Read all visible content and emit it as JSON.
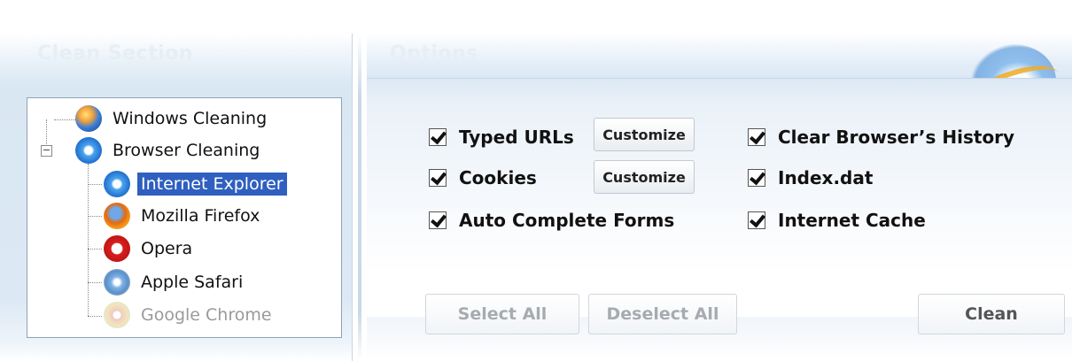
{
  "left_panel": {
    "title": "Clean Section",
    "tree": [
      {
        "label": "Windows Cleaning",
        "icon": "windows-icon"
      },
      {
        "label": "Browser Cleaning",
        "icon": "ie-icon",
        "expanded": true
      },
      {
        "label": "Internet Explorer",
        "icon": "ie-icon",
        "selected": true
      },
      {
        "label": "Mozilla Firefox",
        "icon": "firefox-icon"
      },
      {
        "label": "Opera",
        "icon": "opera-icon"
      },
      {
        "label": "Apple Safari",
        "icon": "safari-icon"
      },
      {
        "label": "Google Chrome",
        "icon": "chrome-icon",
        "disabled": true
      }
    ],
    "expander_symbol": "−"
  },
  "right_panel": {
    "title": "Options",
    "options": [
      {
        "label": "Typed URLs",
        "checked": true
      },
      {
        "label": "Cookies",
        "checked": true
      },
      {
        "label": "Auto Complete Forms",
        "checked": true
      },
      {
        "label": "Clear Browser’s History",
        "checked": true
      },
      {
        "label": "Index.dat",
        "checked": true
      },
      {
        "label": "Internet Cache",
        "checked": true
      }
    ],
    "customize_label": "Customize",
    "buttons": {
      "select_all": "Select All",
      "deselect_all": "Deselect All",
      "clean": "Clean"
    }
  }
}
